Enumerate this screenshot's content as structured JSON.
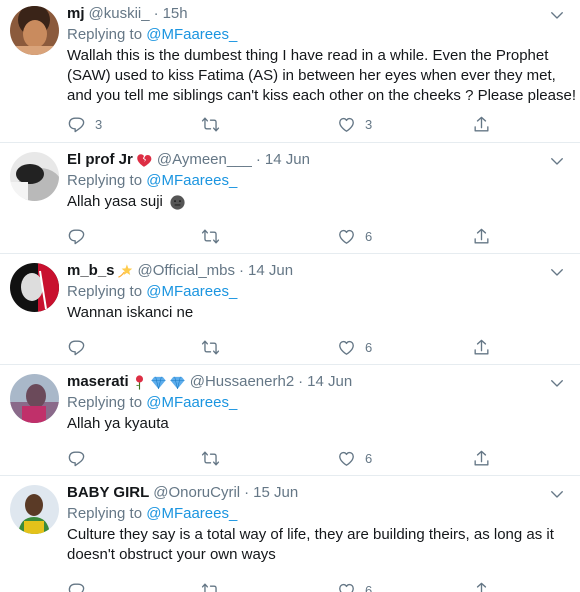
{
  "common": {
    "replying_prefix": "Replying to",
    "dot": "·"
  },
  "tweets": [
    {
      "name": "mj",
      "name_emoji": "",
      "handle": "@kuskii_",
      "time": "15h",
      "replying_to": "@MFaarees_",
      "text": "Wallah this is the dumbest thing I have read in a while. Even the Prophet (SAW) used to kiss Fatima (AS) in between her eyes when ever they met, and you tell me siblings can't kiss each other on the cheeks ? Please please!",
      "reply_count": "3",
      "retweet_count": "",
      "like_count": "3"
    },
    {
      "name": "El prof Jr",
      "name_emoji": "broken-heart",
      "handle": "@Aymeen___",
      "time": "14 Jun",
      "replying_to": "@MFaarees_",
      "text": "Allah yasa suji",
      "text_emoji": "neutral-face",
      "reply_count": "",
      "retweet_count": "",
      "like_count": "6"
    },
    {
      "name": "m_b_s",
      "name_emoji": "dizzy-star",
      "handle": "@Official_mbs",
      "time": "14 Jun",
      "replying_to": "@MFaarees_",
      "text": "Wannan iskanci ne",
      "reply_count": "",
      "retweet_count": "",
      "like_count": "6"
    },
    {
      "name": "maserati",
      "name_emoji": "rose-gems",
      "handle": "@Hussaenerh2",
      "time": "14 Jun",
      "replying_to": "@MFaarees_",
      "text": "Allah ya kyauta",
      "reply_count": "",
      "retweet_count": "",
      "like_count": "6"
    },
    {
      "name": "BABY GIRL",
      "name_emoji": "",
      "handle": "@OnoruCyril",
      "time": "15 Jun",
      "replying_to": "@MFaarees_",
      "text": "Culture they say is a total way of life, they are building theirs, as long as it doesn't obstruct your own ways",
      "reply_count": "",
      "retweet_count": "",
      "like_count": "6"
    }
  ],
  "colors": {
    "text": "#14171a",
    "secondary": "#657786",
    "link": "#1b95e0",
    "divider": "#e6ecf0"
  }
}
